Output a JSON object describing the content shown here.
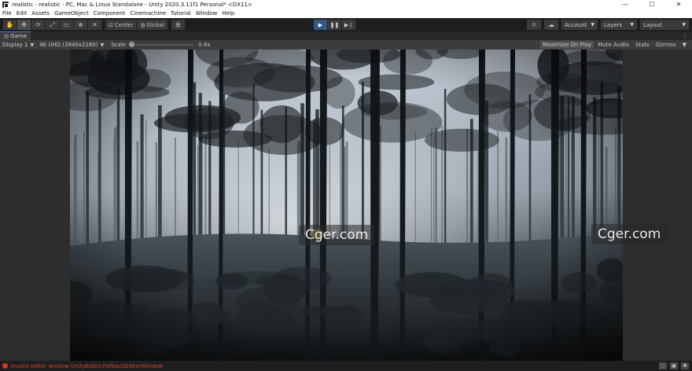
{
  "window": {
    "title": "realistic - realistic - PC, Mac & Linux Standalone - Unity 2020.3.11f1 Personal* <DX11>",
    "controls": {
      "minimize": "—",
      "maximize": "☐",
      "close": "✕"
    }
  },
  "menu": [
    "File",
    "Edit",
    "Assets",
    "GameObject",
    "Component",
    "Cinemachine",
    "Tutorial",
    "Window",
    "Help"
  ],
  "toolbar": {
    "tools": [
      {
        "name": "hand-tool-icon",
        "glyph": "✋"
      },
      {
        "name": "move-tool-icon",
        "glyph": "✥"
      },
      {
        "name": "rotate-tool-icon",
        "glyph": "⟳"
      },
      {
        "name": "scale-tool-icon",
        "glyph": "⤢"
      },
      {
        "name": "rect-tool-icon",
        "glyph": "▭"
      },
      {
        "name": "transform-tool-icon",
        "glyph": "⊕"
      },
      {
        "name": "custom-tool-icon",
        "glyph": "✕"
      }
    ],
    "pivot_label": "Center",
    "space_label": "Global",
    "snap_glyph": "⊞",
    "play_glyph": "▶",
    "pause_glyph": "❚❚",
    "step_glyph": "▶❘",
    "account_label": "Account",
    "layers_label": "Layers",
    "layout_label": "Layout"
  },
  "game_tab": {
    "label": "Game"
  },
  "game_bar": {
    "display": "Display 1",
    "resolution": "4K UHD (3840x2160)",
    "scale_label": "Scale",
    "scale_value": "0.4x",
    "maximize_on_play": "Maximize On Play",
    "mute_audio": "Mute Audio",
    "stats": "Stats",
    "gizmos": "Gizmos"
  },
  "watermarks": [
    "Cger.com",
    "Cger.com"
  ],
  "status": {
    "message": "Invalid editor window UnityEditor.FallbackEditorWindow"
  }
}
